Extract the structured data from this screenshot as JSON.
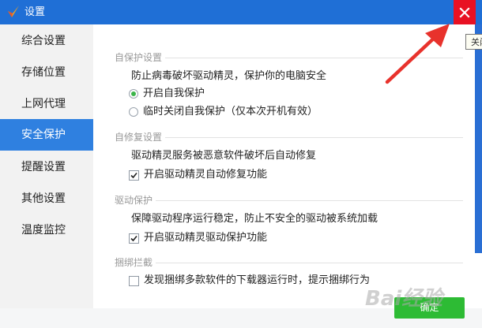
{
  "window": {
    "title": "设置",
    "close_tooltip": "关闭"
  },
  "sidebar": {
    "items": [
      {
        "label": "综合设置",
        "active": false
      },
      {
        "label": "存储位置",
        "active": false
      },
      {
        "label": "上网代理",
        "active": false
      },
      {
        "label": "安全保护",
        "active": true
      },
      {
        "label": "提醒设置",
        "active": false
      },
      {
        "label": "其他设置",
        "active": false
      },
      {
        "label": "温度监控",
        "active": false
      }
    ]
  },
  "main": {
    "self_protect": {
      "title": "自保护设置",
      "desc": "防止病毒破坏驱动精灵，保护你的电脑安全",
      "option_on": "开启自我保护",
      "option_off": "临时关闭自我保护（仅本次开机有效）",
      "selected": "on"
    },
    "self_repair": {
      "title": "自修复设置",
      "desc": "驱动精灵服务被恶意软件破坏后自动修复",
      "checkbox_label": "开启驱动精灵自动修复功能",
      "checked": true
    },
    "driver_protect": {
      "title": "驱动保护",
      "desc": "保障驱动程序运行稳定，防止不安全的驱动被系统加载",
      "checkbox_label": "开启驱动精灵驱动保护功能",
      "checked": true
    },
    "bundle_block": {
      "title": "捆绑拦截",
      "checkbox_label": "发现捆绑多款软件的下载器运行时，提示捆绑行为",
      "checked": false
    }
  },
  "footer": {
    "confirm_label": "确定"
  },
  "watermark": {
    "text": "Bai经验"
  },
  "colors": {
    "titlebar": "#1f6fd6",
    "active_item": "#2f80e0",
    "close": "#e81123",
    "confirm": "#2dbb34",
    "radio_dot": "#3cb44a",
    "annotation_arrow": "#e8322c"
  }
}
